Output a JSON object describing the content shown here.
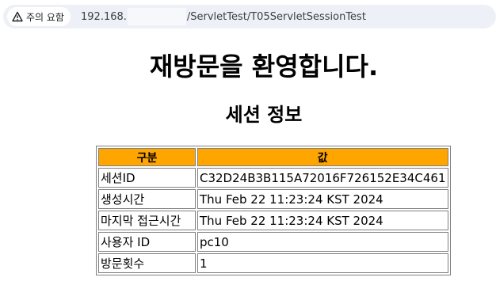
{
  "browser": {
    "security_chip": {
      "icon": "warning-triangle-icon",
      "label": "주의 요함"
    },
    "url": {
      "host_prefix": "192.168.",
      "path": "/ServletTest/T05ServletSessionTest"
    }
  },
  "page": {
    "heading": "재방문을 환영합니다.",
    "subheading": "세션 정보",
    "table": {
      "header_color": "#ffa500",
      "columns": [
        "구분",
        "값"
      ],
      "rows": [
        {
          "key": "세션ID",
          "value": "C32D24B3B115A72016F726152E34C461"
        },
        {
          "key": "생성시간",
          "value": "Thu Feb 22 11:23:24 KST 2024"
        },
        {
          "key": "마지막 접근시간",
          "value": "Thu Feb 22 11:23:24 KST 2024"
        },
        {
          "key": "사용자 ID",
          "value": "pc10"
        },
        {
          "key": "방문횟수",
          "value": "1"
        }
      ]
    }
  }
}
